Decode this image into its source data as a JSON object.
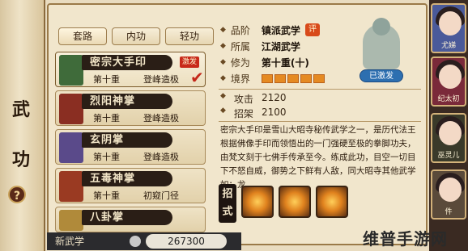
{
  "sidebar": {
    "title_chars": [
      "武",
      "功"
    ],
    "help_glyph": "?"
  },
  "tabs": [
    {
      "label": "套路",
      "active": true
    },
    {
      "label": "内功",
      "active": false
    },
    {
      "label": "轻功",
      "active": false
    }
  ],
  "skills": [
    {
      "name": "密宗大手印",
      "level": "第十重",
      "stage": "登峰造极",
      "badge": "激发",
      "selected": true,
      "icon_color": "#3f6b3a"
    },
    {
      "name": "烈阳神掌",
      "level": "第十重",
      "stage": "登峰造极",
      "selected": false,
      "icon_color": "#8a2e22"
    },
    {
      "name": "玄阴掌",
      "level": "第十重",
      "stage": "登峰造极",
      "selected": false,
      "icon_color": "#5a4a8a"
    },
    {
      "name": "五毒神掌",
      "level": "第十重",
      "stage": "初窥门径",
      "selected": false,
      "icon_color": "#9a3a22"
    },
    {
      "name": "八卦掌",
      "selected": false,
      "icon_color": "#b08a3a"
    }
  ],
  "details": {
    "rank_label": "品阶",
    "rank_value": "镇派武学",
    "rank_ping": "评",
    "school_label": "所属",
    "school_value": "江湖武学",
    "cultivation_label": "修为",
    "cultivation_value": "第十重(十)",
    "realm_label": "境界",
    "realm_bars": 5,
    "portrait_tag": "已激发"
  },
  "stats": [
    {
      "label": "攻击",
      "value": "2120"
    },
    {
      "label": "招架",
      "value": "2100"
    }
  ],
  "description": "密宗大手印是雪山大昭寺秘传武学之一，是历代法王根据佛像手印而领悟出的一门强硬至极的拳脚功夫，由梵文刻于七佛手传承至今。练成此功，目空一切目下不怒自威，御势之下鲜有人敌，同大昭寺其他武学如：龙",
  "moves": {
    "label": "招式",
    "count": 3
  },
  "bottom": {
    "new_skill": "新武学",
    "money": "267300"
  },
  "party": [
    {
      "name": "尤娣",
      "color": "#4a5a9a"
    },
    {
      "name": "纪太初",
      "color": "#7a2a3a"
    },
    {
      "name": "巫灵儿",
      "color": "#3a3a2a"
    },
    {
      "name": "件",
      "color": "#5a4a3a"
    }
  ],
  "watermark": "维普手游网"
}
